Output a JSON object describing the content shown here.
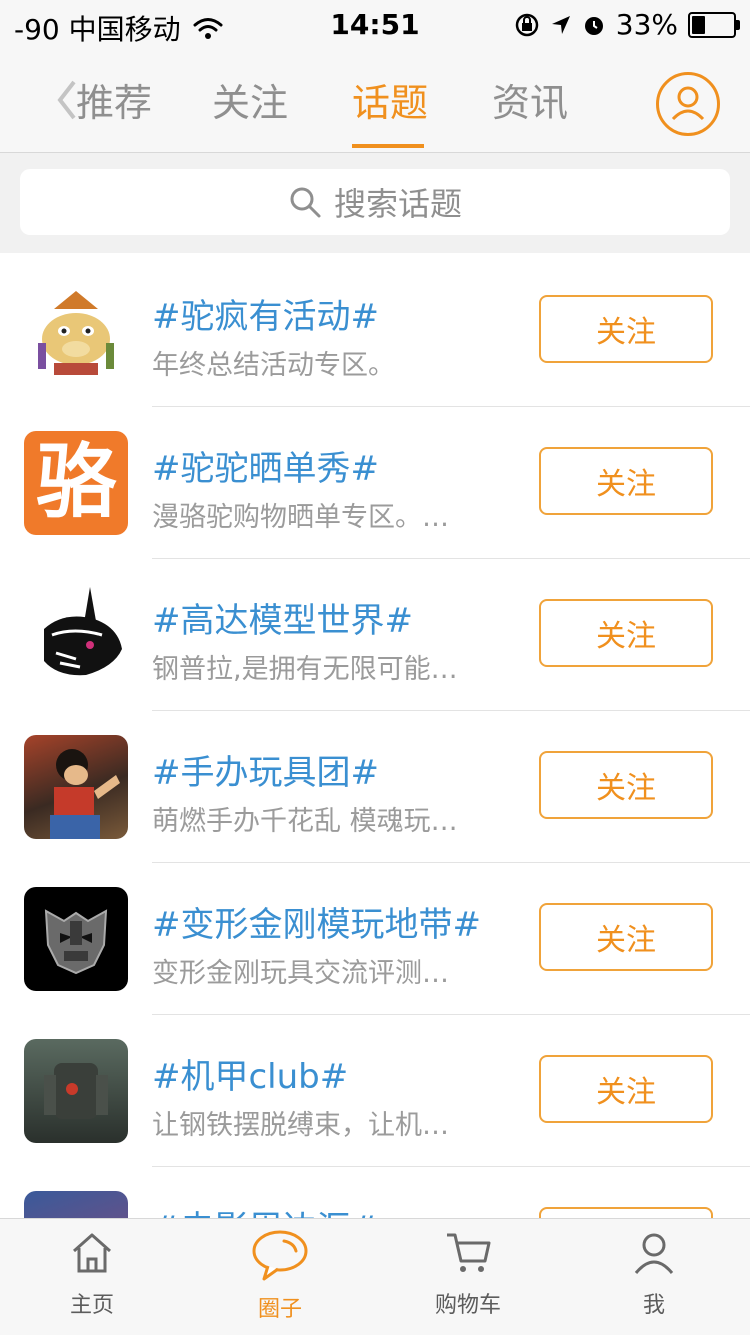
{
  "status_bar": {
    "carrier": "-90 中国移动",
    "time": "14:51",
    "battery": "33%",
    "battery_level": 0.33
  },
  "nav": {
    "tabs": [
      {
        "label": "推荐"
      },
      {
        "label": "关注"
      },
      {
        "label": "话题",
        "active": true
      },
      {
        "label": "资讯"
      }
    ]
  },
  "search": {
    "placeholder": "搜索话题"
  },
  "topics": [
    {
      "title": "#驼疯有活动#",
      "desc": "年终总结活动专区。",
      "follow": "关注"
    },
    {
      "title": "#驼驼晒单秀#",
      "desc": "漫骆驼购物晒单专区。…",
      "follow": "关注"
    },
    {
      "title": "#高达模型世界#",
      "desc": "钢普拉,是拥有无限可能…",
      "follow": "关注"
    },
    {
      "title": "#手办玩具团#",
      "desc": "萌燃手办千花乱 模魂玩…",
      "follow": "关注"
    },
    {
      "title": "#变形金刚模玩地带#",
      "desc": "变形金刚玩具交流评测…",
      "follow": "关注"
    },
    {
      "title": "#机甲club#",
      "desc": "让钢铁摆脱缚束，让机…",
      "follow": "关注"
    },
    {
      "title": "#电影周边汇#",
      "desc": "",
      "follow": "关注"
    }
  ],
  "avatar_text": {
    "luotuo_logo": "骆"
  },
  "tab_bar": {
    "items": [
      {
        "label": "主页",
        "icon": "home-icon"
      },
      {
        "label": "圈子",
        "icon": "chat-bubble-icon",
        "active": true
      },
      {
        "label": "购物车",
        "icon": "cart-icon"
      },
      {
        "label": "我",
        "icon": "person-icon"
      }
    ]
  },
  "colors": {
    "accent": "#f0901e",
    "topic_title": "#3a8fd1",
    "muted": "#9b9b9b"
  }
}
